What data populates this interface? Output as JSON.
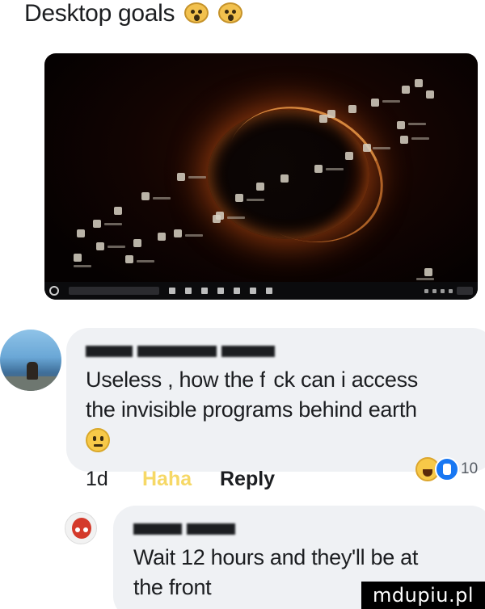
{
  "post": {
    "title": "Desktop goals",
    "title_emojis": [
      "screaming-face-icon",
      "screaming-face-icon"
    ]
  },
  "desktop": {
    "wallpaper": "dark earth with glowing orange rim",
    "accent_glow": "#e66414",
    "taskbar_color": "#0b0b0d"
  },
  "comments": [
    {
      "name": "",
      "text_line_1": "Useless , how the f",
      "text_line_1_tail": "ck can i access",
      "text_line_2": "the invisible programs behind earth",
      "emoji": "neutral-face-icon",
      "time": "1d",
      "reaction_link": "Haha",
      "reply_label": "Reply",
      "reactions": [
        "haha-icon",
        "like-icon"
      ],
      "reaction_count": "10"
    },
    {
      "name": "",
      "text_line_1": "Wait 12 hours and they'll be at",
      "text_line_2": "the front"
    }
  ],
  "watermark": "mdupiu.pl",
  "colors": {
    "bubble_bg": "#eff1f4",
    "like_blue": "#1877f2",
    "haha_yellow": "#f7c948",
    "text": "#1c1e21"
  }
}
